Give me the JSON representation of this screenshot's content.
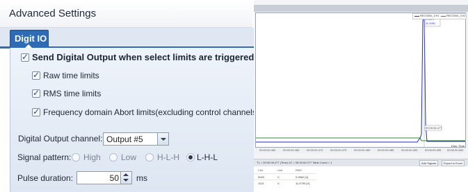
{
  "settings": {
    "title": "Advanced Settings",
    "tab_label": "Digit IO",
    "send_output_label": "Send Digital Output when select limits are triggered",
    "raw_time_label": "Raw time limits",
    "rms_time_label": "RMS time limits",
    "freq_domain_label": "Frequency domain Abort limits(excluding control channels)",
    "channel_label": "Digital Output channel:",
    "channel_value": "Output #5",
    "pattern_label": "Signal pattern:",
    "pattern_options": [
      "High",
      "Low",
      "H-L-H",
      "L-H-L"
    ],
    "pattern_selected": "L-H-L",
    "pulse_label": "Pulse duration:",
    "pulse_value": "50",
    "pulse_unit": "ms"
  },
  "chart": {
    "legend": [
      "REC0000_CH1",
      "REC0000_CH2"
    ],
    "series_colors": [
      "#1f2db8",
      "#2f8a2f"
    ],
    "marker_top": [
      "0.9671",
      "11.0451"
    ],
    "marker_bottom": "00:00:06.477",
    "right_axis_label": "Elan. Time",
    "x_ticks": [
      "00:00:00.460",
      "00:00:00.465",
      "00:00:00.470",
      "00:00:00.475",
      "00:00:00.480",
      "00:00:00.485",
      "00:00:00.490",
      "00:00:00.495",
      "00:00:00.500"
    ],
    "status_text": "T1 = 00:00:06.477 (Time)   ΔT = 00:00:00.077   Table Count = 1",
    "buttons": [
      "Add Signals",
      "Export to Excel"
    ],
    "table_headers": [
      "Ch#",
      "Unit",
      "RMS"
    ],
    "table_rows": [
      [
        "0003",
        "V",
        "0.9962 [V]"
      ],
      [
        "1113",
        "V",
        "11.4790 [V]"
      ]
    ]
  }
}
